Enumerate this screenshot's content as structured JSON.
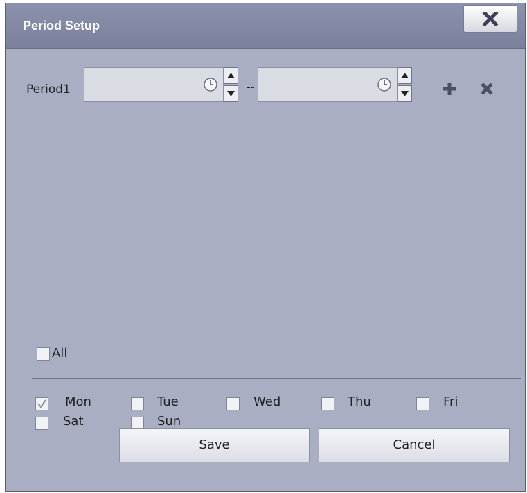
{
  "dialog": {
    "title": "Period Setup"
  },
  "period": {
    "label": "Period1",
    "separator": "--",
    "start_value": "",
    "end_value": ""
  },
  "all_checkbox": {
    "label": "All",
    "checked": false
  },
  "days": [
    {
      "label": "Mon",
      "checked": true
    },
    {
      "label": "Tue",
      "checked": false
    },
    {
      "label": "Wed",
      "checked": false
    },
    {
      "label": "Thu",
      "checked": false
    },
    {
      "label": "Fri",
      "checked": false
    },
    {
      "label": "Sat",
      "checked": false
    },
    {
      "label": "Sun",
      "checked": false
    }
  ],
  "buttons": {
    "save": "Save",
    "cancel": "Cancel"
  },
  "colors": {
    "dialog_bg": "#a9aec3",
    "titlebar": "#7b819c",
    "icon": "#4a5066"
  },
  "icons": {
    "close": "close-icon",
    "clock": "clock-icon",
    "add": "plus-icon",
    "remove": "x-icon",
    "check": "checkmark-icon"
  }
}
